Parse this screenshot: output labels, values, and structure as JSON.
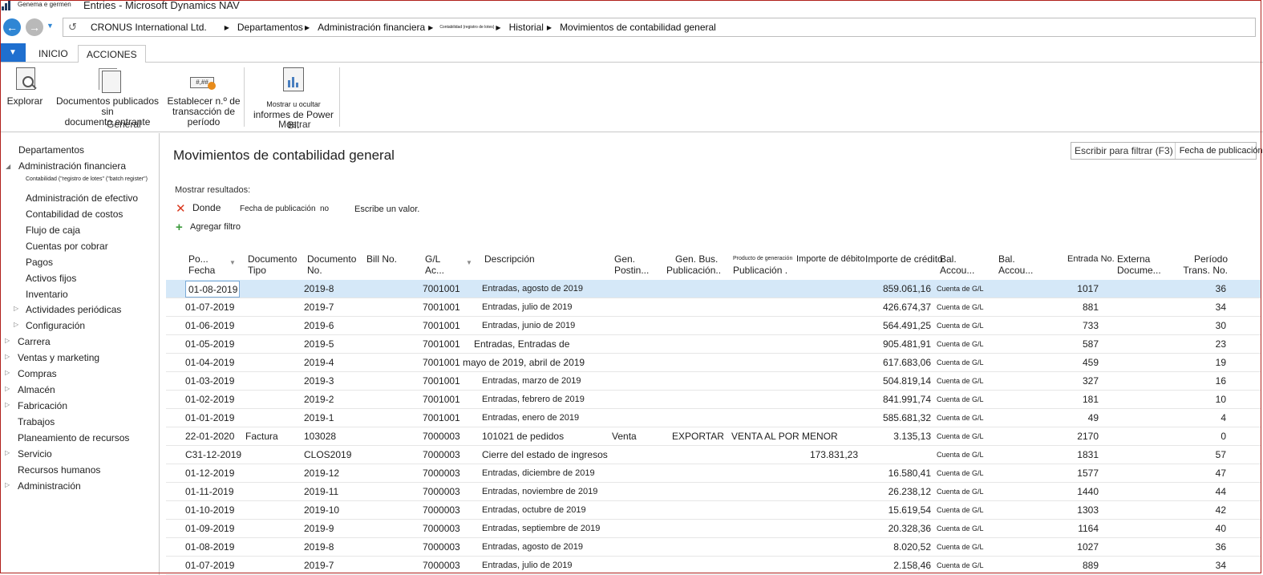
{
  "titlebar": {
    "small_text": "Genema e germen",
    "title": "Entries - Microsoft Dynamics NAV"
  },
  "address": {
    "company": "CRONUS International Ltd.",
    "crumbs": [
      "Departamentos",
      "Administración financiera",
      "Contabilidad (registro de lotes)",
      "Historial",
      "Movimientos de contabilidad general"
    ]
  },
  "ribbon": {
    "app_menu": "▼",
    "tabs": [
      "INICIO",
      "ACCIONES"
    ],
    "buttons": {
      "explore": "Explorar",
      "posted_docs_line1": "Documentos publicados sin",
      "posted_docs_line2": "documento entrante",
      "set_trans_line1": "Establecer n.º de",
      "set_trans_line2": "transacción de período",
      "powerbi_line1": "Mostrar u ocultar",
      "powerbi_line2": "informes de Power BI."
    },
    "groups": {
      "general": "General",
      "show": "Mostrar"
    }
  },
  "navpane": {
    "items": [
      "Departamentos",
      "Administración financiera",
      "Contabilidad (\"registro de lotes\" (\"batch register\")",
      "Administración de efectivo",
      "Contabilidad de costos",
      "Flujo de caja",
      "Cuentas por cobrar",
      "Pagos",
      "Activos fijos",
      "Inventario",
      "Actividades periódicas",
      "Configuración",
      "Carrera",
      "Ventas y marketing",
      "Compras",
      "Almacén",
      "Fabricación",
      "Trabajos",
      "Planeamiento de recursos",
      "Servicio",
      "Recursos humanos",
      "Administración"
    ]
  },
  "page": {
    "title": "Movimientos de contabilidad general"
  },
  "filter": {
    "placeholder": "Escribir para filtrar (F3)",
    "field": "Fecha de publicación"
  },
  "filter_panel": {
    "show_results": "Mostrar resultados:",
    "where": "Donde",
    "field": "Fecha de publicación",
    "operator": "no",
    "value": "Escribe un valor.",
    "add_filter": "Agregar filtro"
  },
  "table": {
    "headers": {
      "posting_date_1": "Po...",
      "posting_date_2": "Fecha",
      "doc_type_1": "Documento",
      "doc_type_2": "Tipo",
      "doc_no_1": "Documento",
      "doc_no_2": "No.",
      "bill_no": "Bill No.",
      "gl_acc_1": "G/L",
      "gl_acc_2": "Ac...",
      "description": "Descripción",
      "gen_posting_1": "Gen.",
      "gen_posting_2": "Postin...",
      "gen_bus_1": "Gen. Bus.",
      "gen_bus_2": "Publicación..",
      "prod_1": "Producto de generación",
      "prod_2": "Publicación .",
      "debit": "Importe de débito",
      "credit": "Importe de crédito",
      "bal_type_1": "Bal.",
      "bal_type_2": "Accou...",
      "bal_no_1": "Bal.",
      "bal_no_2": "Accou...",
      "entry_no": "Entrada No.",
      "ext_doc_1": "Externa",
      "ext_doc_2": "Docume...",
      "period_1": "Período",
      "period_2": "Trans. No."
    },
    "rows": [
      {
        "date": "01-08-2019",
        "type": "",
        "doc": "2019-8",
        "acc": "7001001",
        "desc": "Entradas, agosto de 2019",
        "post": "",
        "bus": "",
        "prod": "",
        "debit": "",
        "credit": "859.061,16",
        "bal": "Cuenta de G/L",
        "entry": "1017",
        "period": "36"
      },
      {
        "date": "01-07-2019",
        "type": "",
        "doc": "2019-7",
        "acc": "7001001",
        "desc": "Entradas, julio de 2019",
        "post": "",
        "bus": "",
        "prod": "",
        "debit": "",
        "credit": "426.674,37",
        "bal": "Cuenta de G/L",
        "entry": "881",
        "period": "34"
      },
      {
        "date": "01-06-2019",
        "type": "",
        "doc": "2019-6",
        "acc": "7001001",
        "desc": "Entradas, junio de 2019",
        "post": "",
        "bus": "",
        "prod": "",
        "debit": "",
        "credit": "564.491,25",
        "bal": "Cuenta de G/L",
        "entry": "733",
        "period": "30"
      },
      {
        "date": "01-05-2019",
        "type": "",
        "doc": "2019-5",
        "acc": "7001001",
        "desc": "Entradas, Entradas de",
        "post": "",
        "bus": "",
        "prod": "",
        "debit": "",
        "credit": "905.481,91",
        "bal": "Cuenta de G/L",
        "entry": "587",
        "period": "23"
      },
      {
        "date": "01-04-2019",
        "type": "",
        "doc": "2019-4",
        "acc": "7001001",
        "desc": "mayo de 2019, abril de 2019",
        "post": "",
        "bus": "",
        "prod": "",
        "debit": "",
        "credit": "617.683,06",
        "bal": "Cuenta de G/L",
        "entry": "459",
        "period": "19"
      },
      {
        "date": "01-03-2019",
        "type": "",
        "doc": "2019-3",
        "acc": "7001001",
        "desc": "Entradas, marzo de 2019",
        "post": "",
        "bus": "",
        "prod": "",
        "debit": "",
        "credit": "504.819,14",
        "bal": "Cuenta de G/L",
        "entry": "327",
        "period": "16"
      },
      {
        "date": "01-02-2019",
        "type": "",
        "doc": "2019-2",
        "acc": "7001001",
        "desc": "Entradas, febrero de 2019",
        "post": "",
        "bus": "",
        "prod": "",
        "debit": "",
        "credit": "841.991,74",
        "bal": "Cuenta de G/L",
        "entry": "181",
        "period": "10"
      },
      {
        "date": "01-01-2019",
        "type": "",
        "doc": "2019-1",
        "acc": "7001001",
        "desc": "Entradas, enero de 2019",
        "post": "",
        "bus": "",
        "prod": "",
        "debit": "",
        "credit": "585.681,32",
        "bal": "Cuenta de G/L",
        "entry": "49",
        "period": "4"
      },
      {
        "date": "22-01-2020",
        "type": "Factura",
        "doc": "103028",
        "acc": "7000003",
        "desc": "101021 de pedidos",
        "post": "Venta",
        "bus": "EXPORTAR",
        "prod": "VENTA AL POR MENOR",
        "debit": "",
        "credit": "3.135,13",
        "bal": "Cuenta de G/L",
        "entry": "2170",
        "period": "0"
      },
      {
        "date": "C31-12-2019",
        "type": "",
        "doc": "CLOS2019",
        "acc": "7000003",
        "desc": "Cierre del estado de ingresos",
        "post": "",
        "bus": "",
        "prod": "",
        "debit": "173.831,23",
        "credit": "",
        "bal": "Cuenta de G/L",
        "entry": "1831",
        "period": "57"
      },
      {
        "date": "01-12-2019",
        "type": "",
        "doc": "2019-12",
        "acc": "7000003",
        "desc": "Entradas, diciembre de 2019",
        "post": "",
        "bus": "",
        "prod": "",
        "debit": "",
        "credit": "16.580,41",
        "bal": "Cuenta de G/L",
        "entry": "1577",
        "period": "47"
      },
      {
        "date": "01-11-2019",
        "type": "",
        "doc": "2019-11",
        "acc": "7000003",
        "desc": "Entradas, noviembre de 2019",
        "post": "",
        "bus": "",
        "prod": "",
        "debit": "",
        "credit": "26.238,12",
        "bal": "Cuenta de G/L",
        "entry": "1440",
        "period": "44"
      },
      {
        "date": "01-10-2019",
        "type": "",
        "doc": "2019-10",
        "acc": "7000003",
        "desc": "Entradas, octubre de 2019",
        "post": "",
        "bus": "",
        "prod": "",
        "debit": "",
        "credit": "15.619,54",
        "bal": "Cuenta de G/L",
        "entry": "1303",
        "period": "42"
      },
      {
        "date": "01-09-2019",
        "type": "",
        "doc": "2019-9",
        "acc": "7000003",
        "desc": "Entradas, septiembre de 2019",
        "post": "",
        "bus": "",
        "prod": "",
        "debit": "",
        "credit": "20.328,36",
        "bal": "Cuenta de G/L",
        "entry": "1164",
        "period": "40"
      },
      {
        "date": "01-08-2019",
        "type": "",
        "doc": "2019-8",
        "acc": "7000003",
        "desc": "Entradas, agosto de 2019",
        "post": "",
        "bus": "",
        "prod": "",
        "debit": "",
        "credit": "8.020,52",
        "bal": "Cuenta de G/L",
        "entry": "1027",
        "period": "36"
      },
      {
        "date": "01-07-2019",
        "type": "",
        "doc": "2019-7",
        "acc": "7000003",
        "desc": "Entradas, julio de 2019",
        "post": "",
        "bus": "",
        "prod": "",
        "debit": "",
        "credit": "2.158,46",
        "bal": "Cuenta de G/L",
        "entry": "889",
        "period": "34"
      }
    ]
  }
}
